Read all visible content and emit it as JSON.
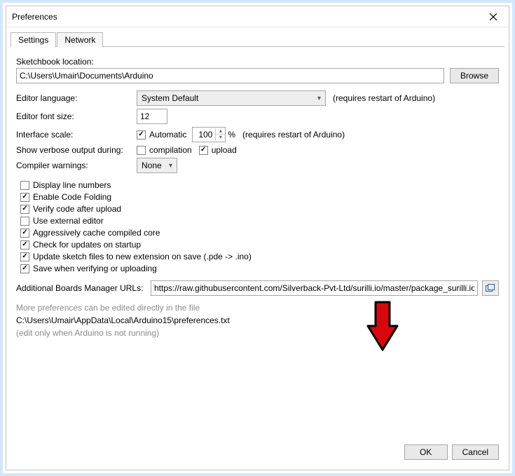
{
  "window": {
    "title": "Preferences"
  },
  "tabs": {
    "settings": "Settings",
    "network": "Network"
  },
  "sketchbook": {
    "label": "Sketchbook location:",
    "value": "C:\\Users\\Umair\\Documents\\Arduino",
    "browse": "Browse"
  },
  "language": {
    "label": "Editor language:",
    "value": "System Default",
    "hint": "(requires restart of Arduino)"
  },
  "font": {
    "label": "Editor font size:",
    "value": "12"
  },
  "scale": {
    "label": "Interface scale:",
    "auto": "Automatic",
    "value": "100",
    "pct": "%",
    "hint": "(requires restart of Arduino)"
  },
  "verbose": {
    "label": "Show verbose output during:",
    "compilation": "compilation",
    "upload": "upload"
  },
  "warnings": {
    "label": "Compiler warnings:",
    "value": "None"
  },
  "checks": {
    "line_numbers": "Display line numbers",
    "code_folding": "Enable Code Folding",
    "verify_upload": "Verify code after upload",
    "external_editor": "Use external editor",
    "cache_core": "Aggressively cache compiled core",
    "check_updates": "Check for updates on startup",
    "update_ext": "Update sketch files to new extension on save (.pde -> .ino)",
    "save_verifying": "Save when verifying or uploading"
  },
  "boards": {
    "label": "Additional Boards Manager URLs:",
    "value": "https://raw.githubusercontent.com/Silverback-Pvt-Ltd/surilli.io/master/package_surilli.io_index.json"
  },
  "more": {
    "line1": "More preferences can be edited directly in the file",
    "path": "C:\\Users\\Umair\\AppData\\Local\\Arduino15\\preferences.txt",
    "line3": "(edit only when Arduino is not running)"
  },
  "buttons": {
    "ok": "OK",
    "cancel": "Cancel"
  }
}
